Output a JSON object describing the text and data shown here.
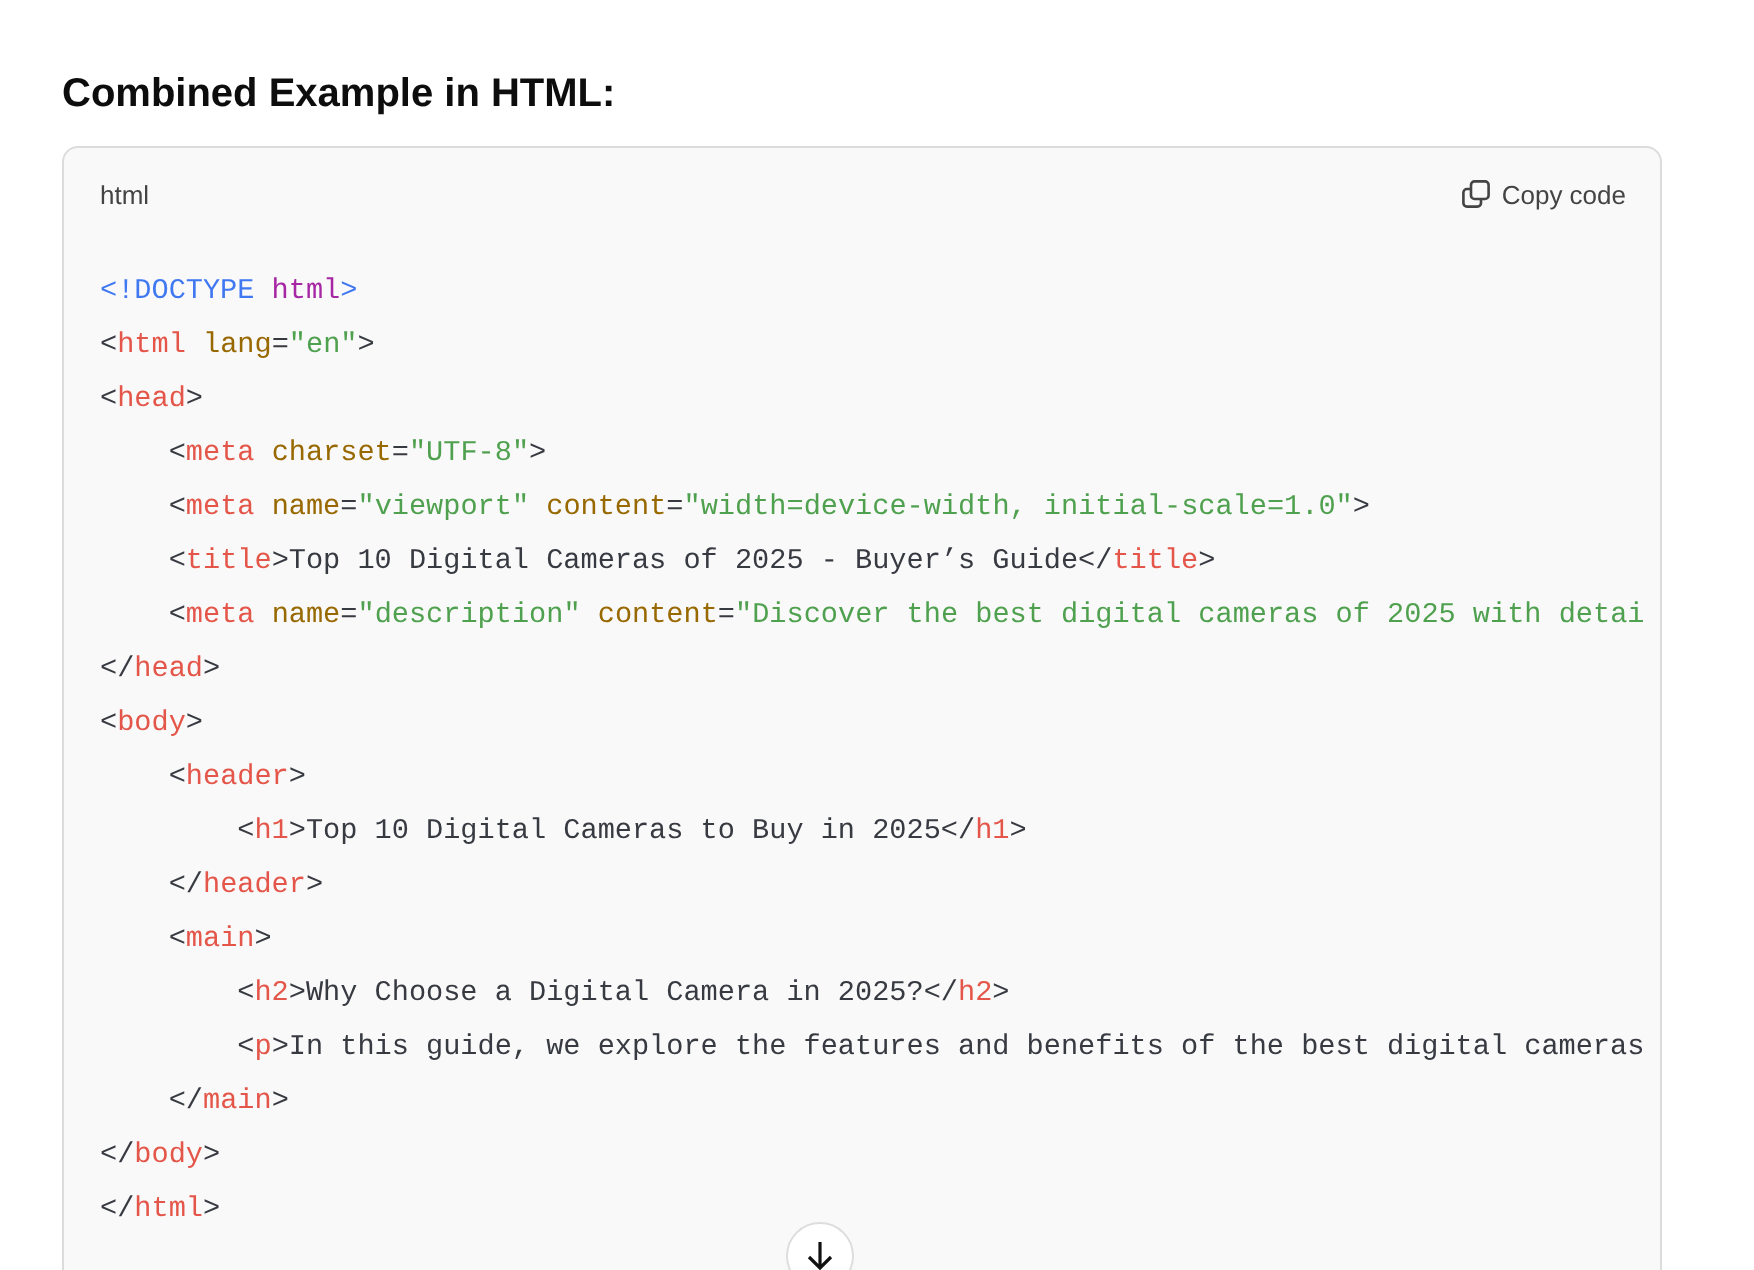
{
  "heading": "Combined Example in HTML:",
  "code_block": {
    "language": "html",
    "copy_label": "Copy code",
    "lines": [
      [
        {
          "text": "<!DOCTYPE ",
          "kind": "doctype"
        },
        {
          "text": "html",
          "kind": "keyword"
        },
        {
          "text": ">",
          "kind": "doctype"
        }
      ],
      [
        {
          "text": "<",
          "kind": "plain"
        },
        {
          "text": "html",
          "kind": "tag"
        },
        {
          "text": " lang",
          "kind": "attr"
        },
        {
          "text": "=",
          "kind": "plain"
        },
        {
          "text": "\"en\"",
          "kind": "string"
        },
        {
          "text": ">",
          "kind": "plain"
        }
      ],
      [
        {
          "text": "<",
          "kind": "plain"
        },
        {
          "text": "head",
          "kind": "tag"
        },
        {
          "text": ">",
          "kind": "plain"
        }
      ],
      [
        {
          "text": "    <",
          "kind": "plain"
        },
        {
          "text": "meta",
          "kind": "tag"
        },
        {
          "text": " charset",
          "kind": "attr"
        },
        {
          "text": "=",
          "kind": "plain"
        },
        {
          "text": "\"UTF-8\"",
          "kind": "string"
        },
        {
          "text": ">",
          "kind": "plain"
        }
      ],
      [
        {
          "text": "    <",
          "kind": "plain"
        },
        {
          "text": "meta",
          "kind": "tag"
        },
        {
          "text": " name",
          "kind": "attr"
        },
        {
          "text": "=",
          "kind": "plain"
        },
        {
          "text": "\"viewport\"",
          "kind": "string"
        },
        {
          "text": " content",
          "kind": "attr"
        },
        {
          "text": "=",
          "kind": "plain"
        },
        {
          "text": "\"width=device-width, initial-scale=1.0\"",
          "kind": "string"
        },
        {
          "text": ">",
          "kind": "plain"
        }
      ],
      [
        {
          "text": "    <",
          "kind": "plain"
        },
        {
          "text": "title",
          "kind": "tag"
        },
        {
          "text": ">Top 10 Digital Cameras of 2025 - Buyer’s Guide</",
          "kind": "plain"
        },
        {
          "text": "title",
          "kind": "tag"
        },
        {
          "text": ">",
          "kind": "plain"
        }
      ],
      [
        {
          "text": "    <",
          "kind": "plain"
        },
        {
          "text": "meta",
          "kind": "tag"
        },
        {
          "text": " name",
          "kind": "attr"
        },
        {
          "text": "=",
          "kind": "plain"
        },
        {
          "text": "\"description\"",
          "kind": "string"
        },
        {
          "text": " content",
          "kind": "attr"
        },
        {
          "text": "=",
          "kind": "plain"
        },
        {
          "text": "\"Discover the best digital cameras of 2025 with detai",
          "kind": "string"
        }
      ],
      [
        {
          "text": "</",
          "kind": "plain"
        },
        {
          "text": "head",
          "kind": "tag"
        },
        {
          "text": ">",
          "kind": "plain"
        }
      ],
      [
        {
          "text": "<",
          "kind": "plain"
        },
        {
          "text": "body",
          "kind": "tag"
        },
        {
          "text": ">",
          "kind": "plain"
        }
      ],
      [
        {
          "text": "    <",
          "kind": "plain"
        },
        {
          "text": "header",
          "kind": "tag"
        },
        {
          "text": ">",
          "kind": "plain"
        }
      ],
      [
        {
          "text": "        <",
          "kind": "plain"
        },
        {
          "text": "h1",
          "kind": "tag"
        },
        {
          "text": ">Top 10 Digital Cameras to Buy in 2025</",
          "kind": "plain"
        },
        {
          "text": "h1",
          "kind": "tag"
        },
        {
          "text": ">",
          "kind": "plain"
        }
      ],
      [
        {
          "text": "    </",
          "kind": "plain"
        },
        {
          "text": "header",
          "kind": "tag"
        },
        {
          "text": ">",
          "kind": "plain"
        }
      ],
      [
        {
          "text": "    <",
          "kind": "plain"
        },
        {
          "text": "main",
          "kind": "tag"
        },
        {
          "text": ">",
          "kind": "plain"
        }
      ],
      [
        {
          "text": "        <",
          "kind": "plain"
        },
        {
          "text": "h2",
          "kind": "tag"
        },
        {
          "text": ">Why Choose a Digital Camera in 2025?</",
          "kind": "plain"
        },
        {
          "text": "h2",
          "kind": "tag"
        },
        {
          "text": ">",
          "kind": "plain"
        }
      ],
      [
        {
          "text": "        <",
          "kind": "plain"
        },
        {
          "text": "p",
          "kind": "tag"
        },
        {
          "text": ">In this guide, we explore the features and benefits of the best digital cameras",
          "kind": "plain"
        }
      ],
      [
        {
          "text": "    </",
          "kind": "plain"
        },
        {
          "text": "main",
          "kind": "tag"
        },
        {
          "text": ">",
          "kind": "plain"
        }
      ],
      [
        {
          "text": "</",
          "kind": "plain"
        },
        {
          "text": "body",
          "kind": "tag"
        },
        {
          "text": ">",
          "kind": "plain"
        }
      ],
      [
        {
          "text": "</",
          "kind": "plain"
        },
        {
          "text": "html",
          "kind": "tag"
        },
        {
          "text": ">",
          "kind": "plain"
        }
      ]
    ]
  }
}
